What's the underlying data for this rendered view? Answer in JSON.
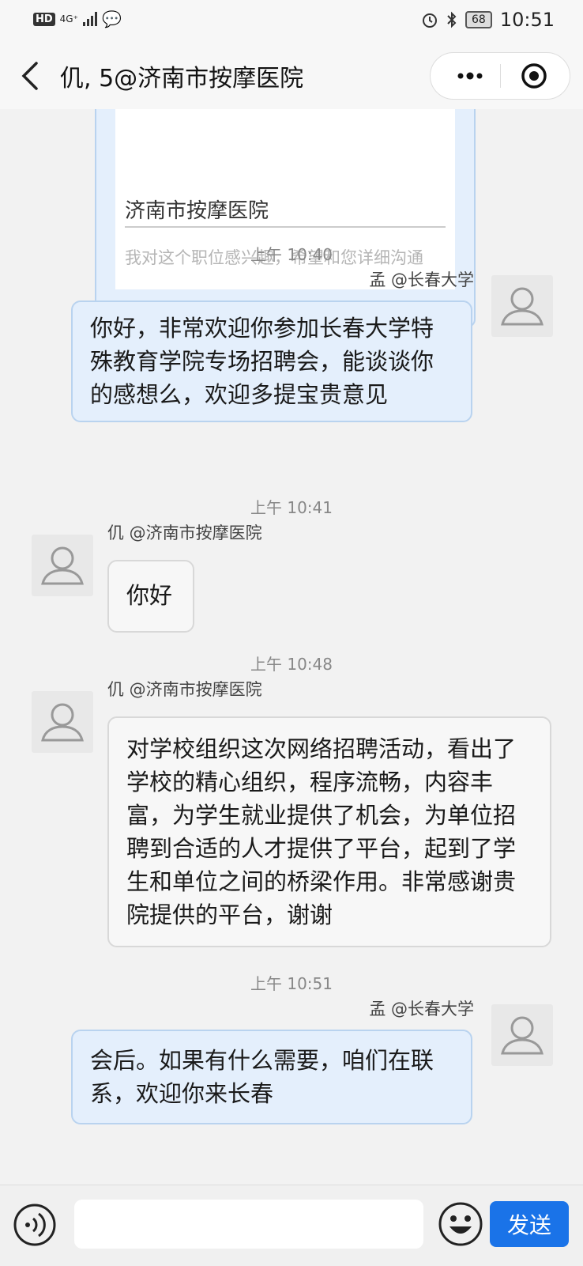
{
  "status_bar": {
    "hd": "HD",
    "network": "4G⁺",
    "battery": "68",
    "time": "10:51"
  },
  "header": {
    "title": "仉, 5@济南市按摩医院"
  },
  "card": {
    "name": "济南市按摩医院",
    "hint": "我对这个职位感兴趣，希望和您详细沟通"
  },
  "messages": [
    {
      "timestamp": "上午 10:40",
      "sender": "孟  @长春大学",
      "text": "你好，非常欢迎你参加长春大学特殊教育学院专场招聘会，能谈谈你的感想么，欢迎多提宝贵意见"
    },
    {
      "timestamp": "上午 10:41",
      "sender": "仉     @济南市按摩医院",
      "text": "你好"
    },
    {
      "timestamp": "上午 10:48",
      "sender": "仉  @济南市按摩医院",
      "text": "对学校组织这次网络招聘活动，看出了学校的精心组织，程序流畅，内容丰富，为学生就业提供了机会，为单位招聘到合适的人才提供了平台，起到了学生和单位之间的桥梁作用。非常感谢贵院提供的平台，谢谢"
    },
    {
      "timestamp": "上午 10:51",
      "sender": "孟  @长春大学",
      "text": "会后。如果有什么需要，咱们在联系，欢迎你来长春"
    }
  ],
  "input": {
    "placeholder": "",
    "send_label": "发送"
  }
}
